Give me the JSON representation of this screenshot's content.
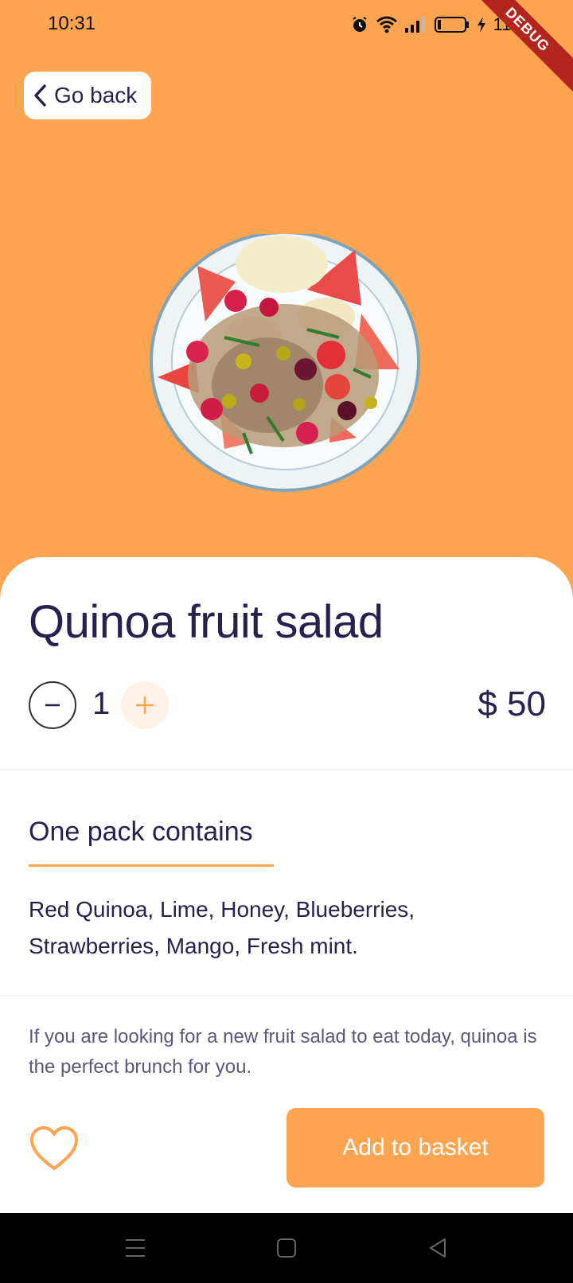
{
  "status_bar": {
    "time": "10:31",
    "battery": "11%",
    "debug_label": "DEBUG",
    "icons": [
      "alarm-icon",
      "wifi-icon",
      "signal-icon",
      "battery-icon",
      "charging-icon"
    ]
  },
  "header": {
    "back_label": "Go back",
    "back_icon": "chevron-left-icon"
  },
  "hero": {
    "image": "quinoa-fruit-salad-plate",
    "background_color": "#FFA451"
  },
  "product": {
    "title": "Quinoa fruit salad",
    "quantity": "1",
    "price": "$ 50"
  },
  "contents": {
    "section_title": "One pack contains",
    "ingredients": "Red Quinoa, Lime, Honey, Blueberries, Strawberries, Mango, Fresh mint."
  },
  "description": "If you are looking for a new fruit salad to eat today, quinoa is the perfect brunch for you.",
  "actions": {
    "favorite_icon": "heart-outline-icon",
    "add_to_basket": "Add to basket"
  },
  "colors": {
    "accent": "#FFA451",
    "accent_light": "#FFF2E7",
    "text_dark": "#27214D",
    "text_muted": "#5D577E"
  },
  "nav_bar": {
    "icons": [
      "menu-icon",
      "home-icon",
      "back-icon"
    ]
  }
}
